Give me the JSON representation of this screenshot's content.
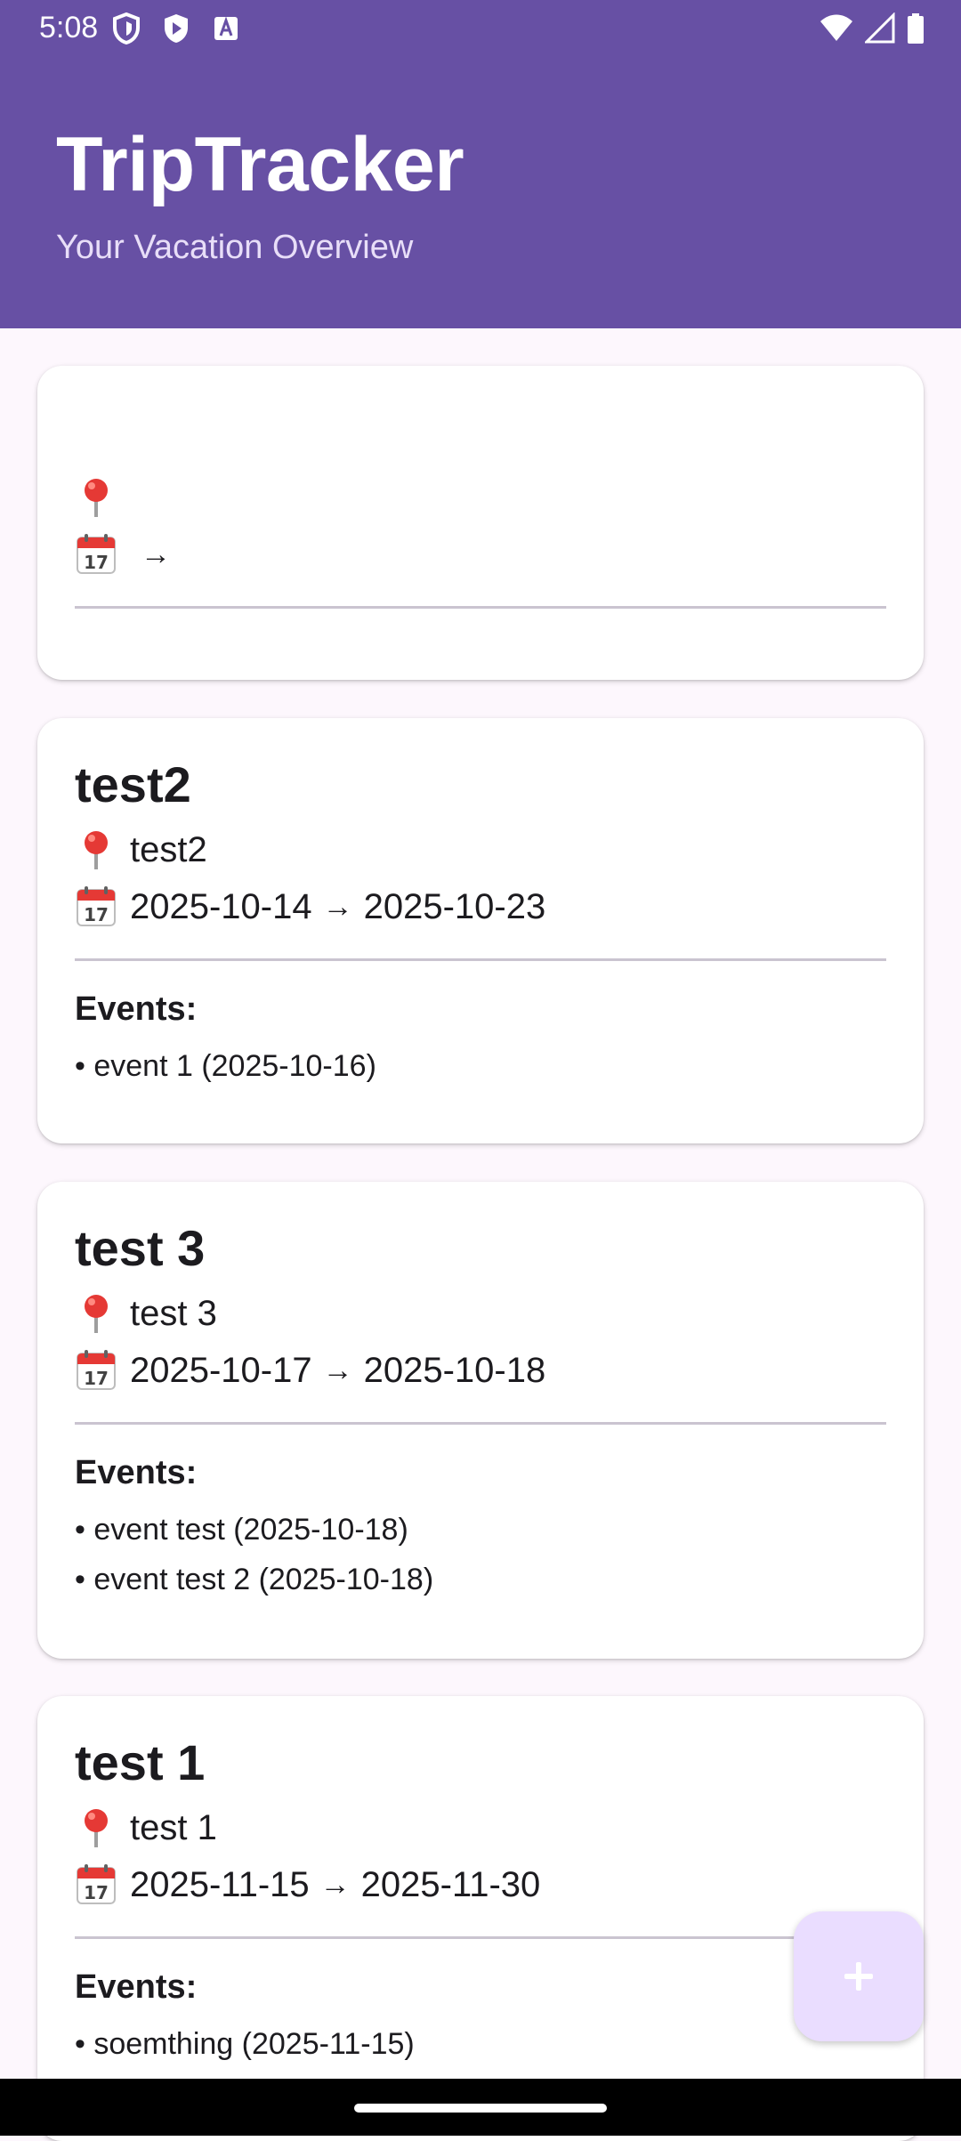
{
  "status_bar": {
    "time": "5:08",
    "left_icons": [
      "shield-icon",
      "play-protect-icon",
      "text-a-icon"
    ],
    "right_icons": [
      "wifi-icon",
      "signal-icon",
      "battery-icon"
    ]
  },
  "header": {
    "title": "TripTracker",
    "subtitle": "Your Vacation Overview",
    "color": "#6750A4"
  },
  "cards": [
    {
      "title": "",
      "location": "",
      "start_date": "",
      "end_date": "",
      "arrow": "→",
      "events_label": "",
      "events": []
    },
    {
      "title": "test2",
      "location": "test2",
      "start_date": "2025-10-14",
      "end_date": "2025-10-23",
      "arrow": "→",
      "events_label": "Events:",
      "events": [
        "• event 1 (2025-10-16)"
      ]
    },
    {
      "title": "test 3",
      "location": "test 3",
      "start_date": "2025-10-17",
      "end_date": "2025-10-18",
      "arrow": "→",
      "events_label": "Events:",
      "events": [
        "• event test (2025-10-18)",
        "• event test 2 (2025-10-18)"
      ]
    },
    {
      "title": "test 1",
      "location": "test 1",
      "start_date": "2025-11-15",
      "end_date": "2025-11-30",
      "arrow": "→",
      "events_label": "Events:",
      "events": [
        "• soemthing (2025-11-15)"
      ]
    }
  ],
  "fab": {
    "icon": "plus-icon",
    "color": "#EADDFF"
  }
}
